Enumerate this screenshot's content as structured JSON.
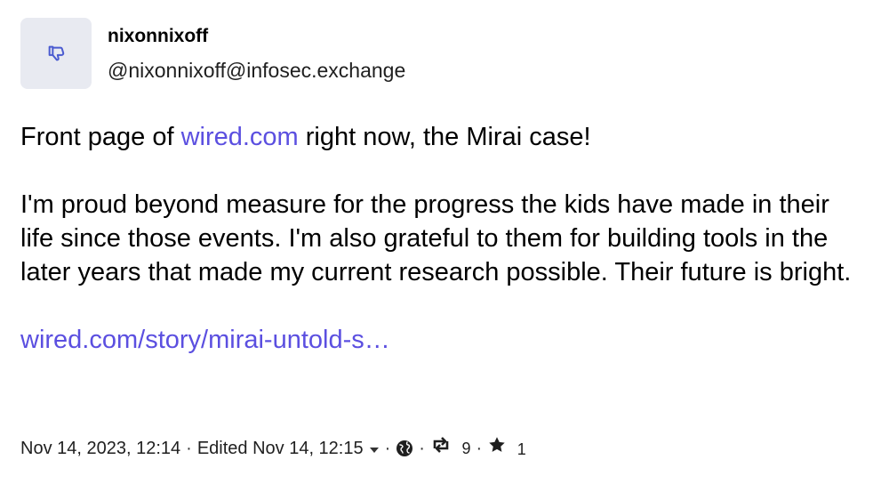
{
  "account": {
    "display_name": "nixonnixoff",
    "handle": "@nixonnixoff@infosec.exchange",
    "avatar_icon": "thumbs-down-icon",
    "avatar_bg": "#e8eaf1"
  },
  "post": {
    "line1_prefix": "Front page of ",
    "line1_link": "wired.com",
    "line1_suffix": " right now, the Mirai case!",
    "paragraph2": "I'm proud beyond measure for the progress the kids have made in their life since those events. I'm also grateful to them for building tools in the later years that made my current research possible. Their future is bright.",
    "story_link": "wired.com/story/mirai-untold-s…",
    "link_color": "#5b4fe0"
  },
  "meta": {
    "timestamp": "Nov 14, 2023, 12:14",
    "separator": "·",
    "edited": "Edited Nov 14, 12:15",
    "edited_caret_icon": "caret-down-icon",
    "visibility_icon": "globe-icon",
    "boost_icon": "boost-icon",
    "boost_count": "9",
    "favourite_icon": "star-icon",
    "favourite_count": "1"
  }
}
